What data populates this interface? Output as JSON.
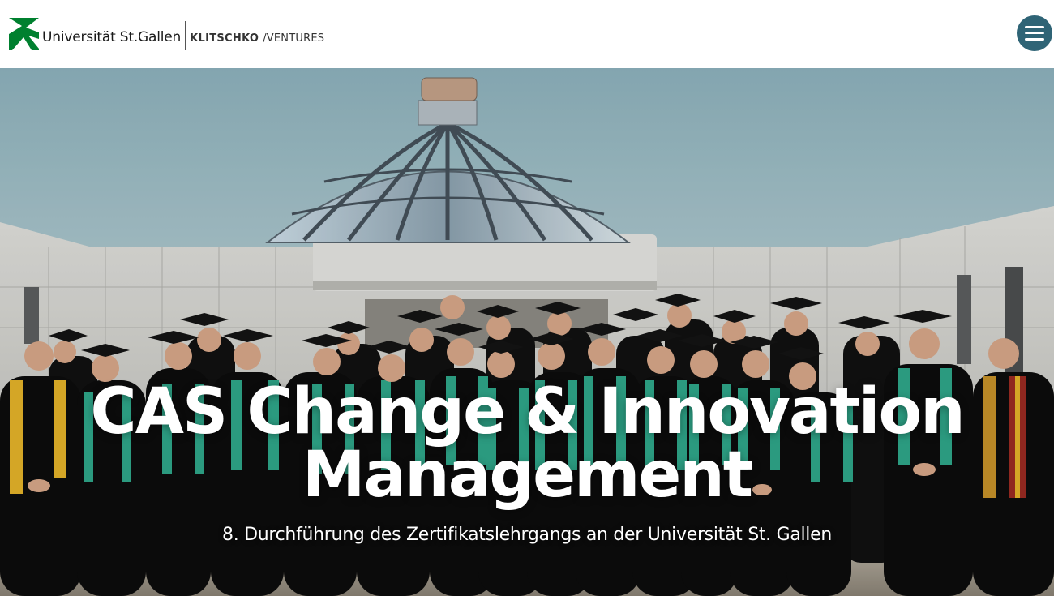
{
  "header": {
    "university_name": "Universität St.Gallen",
    "partner_bold": "KLITSCHKO",
    "partner_light": "/VENTURES",
    "menu_icon": "hamburger-menu-icon",
    "menu_color": "#2f6476"
  },
  "hero": {
    "title_line_1": "CAS Change & Innovation",
    "title_line_2": "Management",
    "subtitle": "8. Durchführung des Zertifikatslehrgangs an der Universität St. Gallen",
    "image": "graduation-group-photo"
  },
  "colors": {
    "brand_green": "#00802f",
    "stole_green": "#2fa88a",
    "stole_gold": "#e6b52a",
    "stole_red": "#9c2b22"
  }
}
